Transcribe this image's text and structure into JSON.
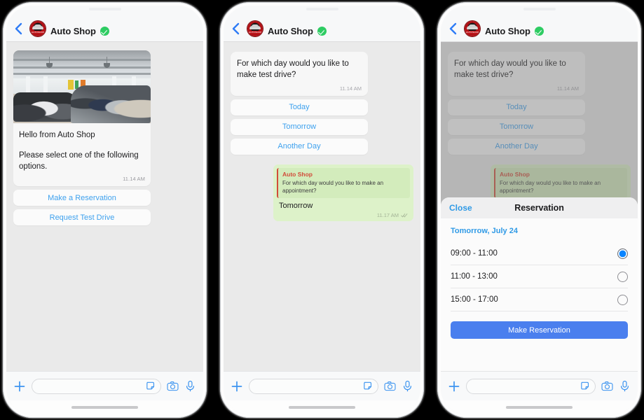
{
  "header": {
    "back_icon": "back-chevron-icon",
    "title": "Auto Shop",
    "verified_icon": "verified-check-icon",
    "avatar_label": "AUTOSHOP"
  },
  "phone1": {
    "card": {
      "image_alt": "car-dealership-showroom-photo",
      "greeting": "Hello from Auto Shop",
      "instruction": "Please select one of the following options.",
      "time": "11.14 AM"
    },
    "options": [
      {
        "label": "Make a Reservation"
      },
      {
        "label": "Request Test Drive"
      }
    ]
  },
  "phone2": {
    "incoming": {
      "text": "For which day would you like to make test drive?",
      "time": "11.14 AM"
    },
    "options": [
      {
        "label": "Today"
      },
      {
        "label": "Tomorrow"
      },
      {
        "label": "Another Day"
      }
    ],
    "outgoing": {
      "quote_name": "Auto Shop",
      "quote_text": "For which day would you like to make an appointment?",
      "text": "Tomorrow",
      "time": "11.17 AM",
      "status_icon": "double-check-icon"
    }
  },
  "phone3": {
    "incoming": {
      "text": "For which day would you like to make test drive?",
      "time": "11.14 AM"
    },
    "options": [
      {
        "label": "Today"
      },
      {
        "label": "Tomorrow"
      },
      {
        "label": "Another Day"
      }
    ],
    "outgoing": {
      "quote_name": "Auto Shop",
      "quote_text": "For which day would you like to make an appointment?"
    },
    "sheet": {
      "close_label": "Close",
      "title": "Reservation",
      "date_label": "Tomorrow, July 24",
      "slots": [
        {
          "label": "09:00 - 11:00",
          "selected": true
        },
        {
          "label": "11:00 - 13:00",
          "selected": false
        },
        {
          "label": "15:00 - 17:00",
          "selected": false
        }
      ],
      "cta_label": "Make Reservation"
    }
  },
  "input_bar": {
    "plus_icon": "plus-icon",
    "input_value": "",
    "input_placeholder": "",
    "sticker_icon": "sticker-icon",
    "camera_icon": "camera-icon",
    "mic_icon": "microphone-icon"
  },
  "colors": {
    "accent_blue": "#3ea1ee",
    "cta_blue": "#4a7fee",
    "radio_blue": "#0a84ff",
    "verified_green": "#2ecc63",
    "bubble_green": "#ddf2c9",
    "quote_red": "#d24b3a",
    "chat_bg": "#eaeaea"
  }
}
